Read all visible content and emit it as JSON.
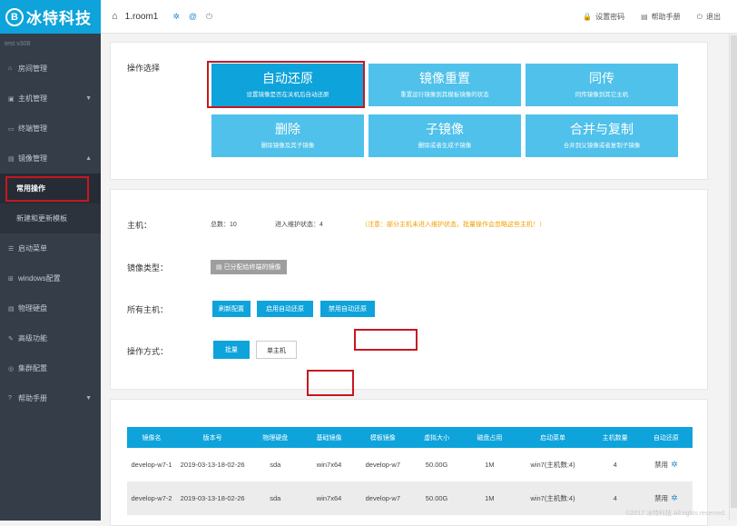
{
  "app": {
    "logo_letter": "B",
    "logo_text": "冰特科技",
    "version": "test  v308"
  },
  "sidebar": {
    "items": [
      {
        "icon": "home-icon",
        "glyph": "⌂",
        "label": "房间管理"
      },
      {
        "icon": "server-icon",
        "glyph": "▣",
        "label": "主机管理",
        "caret": "▼"
      },
      {
        "icon": "terminal-icon",
        "glyph": "▭",
        "label": "终端管理"
      },
      {
        "icon": "image-icon",
        "glyph": "▤",
        "label": "镜像管理",
        "caret": "▲"
      }
    ],
    "subitems": [
      {
        "label": "常用操作"
      },
      {
        "label": "新建和更新模板"
      }
    ],
    "items2": [
      {
        "icon": "menu-icon",
        "glyph": "☰",
        "label": "启动菜单"
      },
      {
        "icon": "windows-icon",
        "glyph": "⊞",
        "label": "windows配置"
      },
      {
        "icon": "disk-icon",
        "glyph": "▤",
        "label": "物理硬盘"
      },
      {
        "icon": "tools-icon",
        "glyph": "✎",
        "label": "高级功能"
      },
      {
        "icon": "cluster-icon",
        "glyph": "◎",
        "label": "集群配置"
      },
      {
        "icon": "help-icon",
        "glyph": "?",
        "label": "帮助手册",
        "caret": "▼"
      }
    ]
  },
  "topbar": {
    "home_glyph": "⌂",
    "room": "1.room1",
    "icons": [
      {
        "name": "settings-icon",
        "glyph": "✲"
      },
      {
        "name": "at-icon",
        "glyph": "@"
      },
      {
        "name": "power-icon",
        "glyph": "⏻"
      }
    ],
    "links": [
      {
        "name": "set-password-link",
        "glyph": "🔒",
        "label": "设置密码"
      },
      {
        "name": "help-manual-link",
        "glyph": "▤",
        "label": "帮助手册"
      },
      {
        "name": "logout-link",
        "glyph": "⏻",
        "label": "退出"
      }
    ]
  },
  "operations": {
    "label": "操作选择",
    "tiles": [
      {
        "title": "自动还原",
        "sub": "设置镜像是否在关机后自动还原",
        "selected": true
      },
      {
        "title": "镜像重置",
        "sub": "重置运行镜像到其模板镜像的状态"
      },
      {
        "title": "同传",
        "sub": "同传镜像到其它主机"
      },
      {
        "title": "删除",
        "sub": "删除镜像及其子镜像"
      },
      {
        "title": "子镜像",
        "sub": "删除或者生成子镜像"
      },
      {
        "title": "合并与复制",
        "sub": "合并到父镜像或者复制子镜像"
      }
    ]
  },
  "settings": {
    "host_label": "主机：",
    "total": "总数：10",
    "maintenance": "进入维护状态：4",
    "note": "（注意：部分主机未进入维护状态，批量操作会忽略这些主机！）",
    "image_type_label": "镜像类型：",
    "image_type_value": "已分配给终端的镜像",
    "all_hosts_label": "所有主机：",
    "btn_refresh": "刷新配置",
    "btn_enable": "启用自动还原",
    "btn_disable": "禁用自动还原",
    "mode_label": "操作方式：",
    "btn_batch": "批量",
    "btn_single": "单主机"
  },
  "table": {
    "headers": [
      "镜像名",
      "版本号",
      "物理硬盘",
      "基础镜像",
      "模板镜像",
      "虚拟大小",
      "磁盘占用",
      "启动菜单",
      "主机数量",
      "自动还原"
    ],
    "rows": [
      [
        "develop-w7-1",
        "2019-03-13-18-02-26",
        "sda",
        "win7x64",
        "develop-w7",
        "50.00G",
        "1M",
        "win7(主机数:4)",
        "4",
        "禁用"
      ],
      [
        "develop-w7-2",
        "2019-03-13-18-02-26",
        "sda",
        "win7x64",
        "develop-w7",
        "50.00G",
        "1M",
        "win7(主机数:4)",
        "4",
        "禁用"
      ]
    ]
  },
  "footer": "©2017 冰特科技 All rights reserved.",
  "colors": {
    "accent": "#0ea3da",
    "tile": "#4fc1ea",
    "sidebar": "#353d49",
    "highlight": "#c8171e",
    "warn": "#f0a000"
  }
}
